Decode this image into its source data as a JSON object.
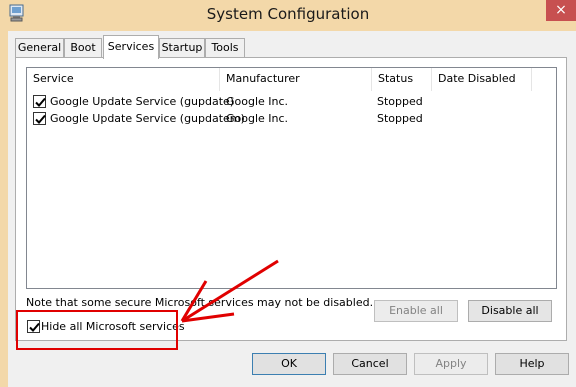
{
  "window": {
    "title": "System Configuration",
    "close_glyph": "×",
    "icon": "msconfig-icon"
  },
  "tabs": [
    {
      "label": "General"
    },
    {
      "label": "Boot"
    },
    {
      "label": "Services",
      "active": true
    },
    {
      "label": "Startup"
    },
    {
      "label": "Tools"
    }
  ],
  "services": {
    "columns": [
      "Service",
      "Manufacturer",
      "Status",
      "Date Disabled"
    ],
    "rows": [
      {
        "checked": true,
        "service": "Google Update Service (gupdate)",
        "manufacturer": "Google Inc.",
        "status": "Stopped",
        "date_disabled": ""
      },
      {
        "checked": true,
        "service": "Google Update Service (gupdatem)",
        "manufacturer": "Google Inc.",
        "status": "Stopped",
        "date_disabled": ""
      }
    ]
  },
  "note": "Note that some secure Microsoft services may not be disabled.",
  "buttons": {
    "enable_all": "Enable all",
    "disable_all": "Disable all",
    "ok": "OK",
    "cancel": "Cancel",
    "apply": "Apply",
    "help": "Help"
  },
  "hide_microsoft": {
    "label": "Hide all Microsoft services",
    "checked": true
  },
  "annotation": {
    "color": "#e00000"
  }
}
